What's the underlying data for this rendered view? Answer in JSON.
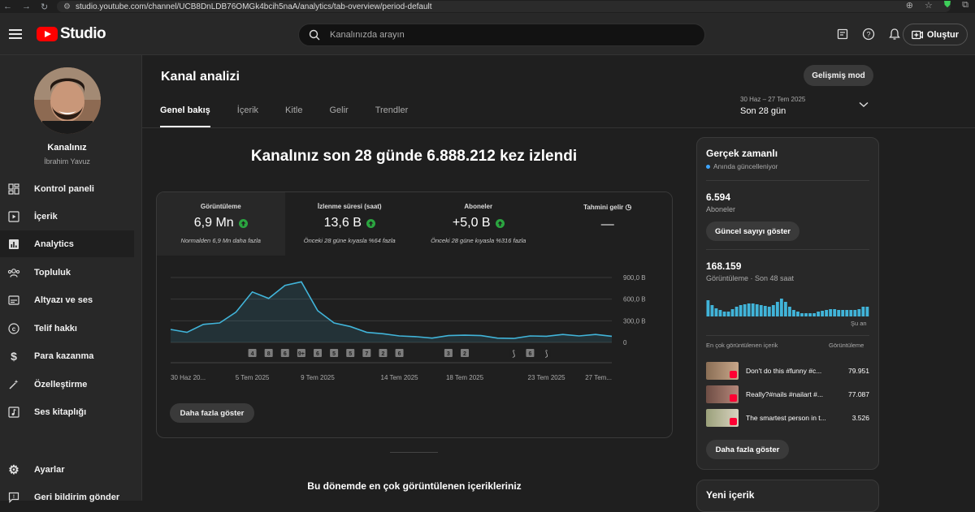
{
  "browser": {
    "url": "studio.youtube.com/channel/UCB8DnLDB76OMGk4bcih5naA/analytics/tab-overview/period-default"
  },
  "topbar": {
    "logo_text": "Studio",
    "search_placeholder": "Kanalınızda arayın",
    "create_label": "Oluştur"
  },
  "sidebar": {
    "channel_name": "Kanalınız",
    "user_name": "İbrahim Yavuz",
    "items": [
      {
        "label": "Kontrol paneli",
        "icon": "dashboard-icon"
      },
      {
        "label": "İçerik",
        "icon": "content-icon"
      },
      {
        "label": "Analytics",
        "icon": "analytics-icon"
      },
      {
        "label": "Topluluk",
        "icon": "community-icon"
      },
      {
        "label": "Altyazı ve ses",
        "icon": "subtitles-icon"
      },
      {
        "label": "Telif hakkı",
        "icon": "copyright-icon"
      },
      {
        "label": "Para kazanma",
        "icon": "dollar-icon"
      },
      {
        "label": "Özelleştirme",
        "icon": "magic-wand-icon"
      },
      {
        "label": "Ses kitaplığı",
        "icon": "audio-library-icon"
      },
      {
        "label": "Ayarlar",
        "icon": "gear-icon"
      },
      {
        "label": "Geri bildirim gönder",
        "icon": "feedback-icon"
      }
    ]
  },
  "main": {
    "title": "Kanal analizi",
    "advanced_mode": "Gelişmiş mod",
    "tabs": [
      "Genel bakış",
      "İçerik",
      "Kitle",
      "Gelir",
      "Trendler"
    ],
    "period_range": "30 Haz – 27 Tem 2025",
    "period_label": "Son 28 gün",
    "headline": "Kanalınız son 28 günde 6.888.212 kez izlendi",
    "metrics": [
      {
        "title": "Görüntüleme",
        "value": "6,9 Mn",
        "sub": "Normalden 6,9 Mn daha fazla"
      },
      {
        "title": "İzlenme süresi (saat)",
        "value": "13,6 B",
        "sub": "Önceki 28 güne kıyasla %64 fazla"
      },
      {
        "title": "Aboneler",
        "value": "+5,0 B",
        "sub": "Önceki 28 güne kıyasla %316 fazla"
      },
      {
        "title": "Tahmini gelir",
        "value": "—",
        "sub": ""
      }
    ],
    "show_more": "Daha fazla göster",
    "top_content_title": "Bu dönemde en çok görüntülenen içerikleriniz"
  },
  "chart_data": {
    "type": "area",
    "x": [
      "30 Haz",
      "1 Tem",
      "2 Tem",
      "3 Tem",
      "4 Tem",
      "5 Tem",
      "6 Tem",
      "7 Tem",
      "8 Tem",
      "9 Tem",
      "10 Tem",
      "11 Tem",
      "12 Tem",
      "13 Tem",
      "14 Tem",
      "15 Tem",
      "16 Tem",
      "17 Tem",
      "18 Tem",
      "19 Tem",
      "20 Tem",
      "21 Tem",
      "22 Tem",
      "23 Tem",
      "24 Tem",
      "25 Tem",
      "26 Tem",
      "27 Tem"
    ],
    "series": [
      {
        "values": [
          180,
          140,
          250,
          270,
          420,
          700,
          610,
          790,
          840,
          440,
          270,
          220,
          140,
          120,
          90,
          80,
          60,
          95,
          100,
          95,
          60,
          55,
          90,
          85,
          110,
          90,
          110,
          85
        ]
      }
    ],
    "ylim": [
      0,
      900
    ],
    "yticks": [
      "900,0 B",
      "600,0 B",
      "300,0 B",
      "0"
    ],
    "ytick_values": [
      900,
      600,
      300,
      0
    ],
    "xtick_labels": [
      "30 Haz 20...",
      "5 Tem 2025",
      "9 Tem 2025",
      "14 Tem 2025",
      "18 Tem 2025",
      "23 Tem 2025",
      "27 Tem..."
    ],
    "xtick_index": [
      0,
      5,
      9,
      14,
      18,
      23,
      27
    ],
    "markers": [
      {
        "label": "4",
        "index": 5
      },
      {
        "label": "8",
        "index": 6
      },
      {
        "label": "6",
        "index": 7
      },
      {
        "label": "9+",
        "index": 8
      },
      {
        "label": "6",
        "index": 9
      },
      {
        "label": "5",
        "index": 10
      },
      {
        "label": "5",
        "index": 11
      },
      {
        "label": "7",
        "index": 12
      },
      {
        "label": "2",
        "index": 13
      },
      {
        "label": "6",
        "index": 14
      },
      {
        "label": "3",
        "index": 17
      },
      {
        "label": "2",
        "index": 18
      },
      {
        "label": "",
        "index": 21
      },
      {
        "label": "6",
        "index": 22
      },
      {
        "label": "",
        "index": 23
      }
    ],
    "grid": true,
    "color": "#41b4d9"
  },
  "realtime": {
    "title": "Gerçek zamanlı",
    "subtitle": "Anında güncelleniyor",
    "subscribers_value": "6.594",
    "subscribers_label": "Aboneler",
    "show_count_btn": "Güncel sayıyı göster",
    "views_value": "168.159",
    "views_label": "Görüntüleme · Son 48 saat",
    "now_label": "Şu an",
    "top_label": "En çok görüntülenen içerik",
    "views_col": "Görüntüleme",
    "bars": [
      20,
      14,
      10,
      8,
      6,
      6,
      9,
      12,
      14,
      15,
      16,
      16,
      15,
      14,
      13,
      12,
      14,
      18,
      22,
      18,
      12,
      8,
      6,
      4,
      4,
      4,
      4,
      6,
      7,
      8,
      9,
      9,
      8,
      8,
      8,
      8,
      8,
      9,
      12,
      12
    ],
    "videos": [
      {
        "title": "Don't do this #funny #c...",
        "views": "79.951"
      },
      {
        "title": "Really?#nails #nailart #...",
        "views": "77.087"
      },
      {
        "title": "The smartest person in t...",
        "views": "3.526"
      }
    ],
    "show_more": "Daha fazla göster"
  },
  "new_content": {
    "title": "Yeni içerik"
  }
}
